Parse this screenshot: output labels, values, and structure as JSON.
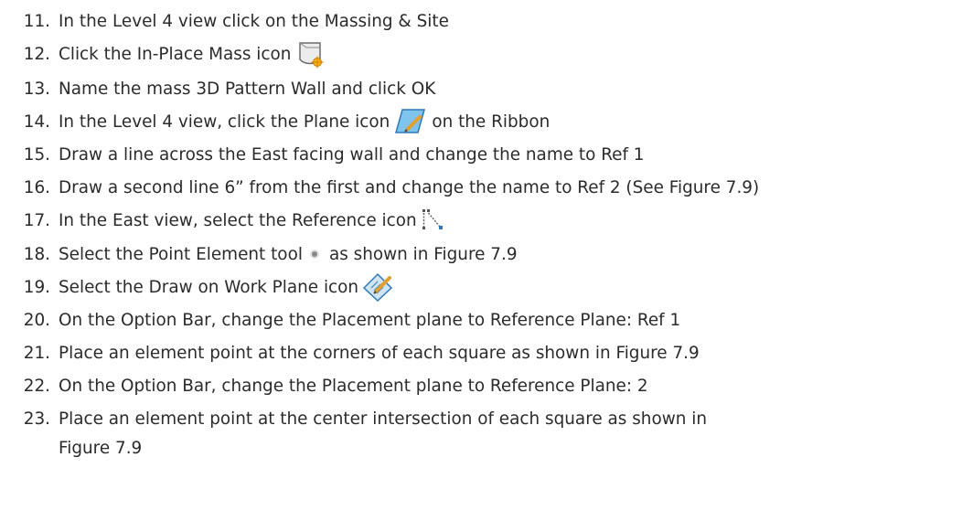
{
  "steps": [
    {
      "number": "11.",
      "text": "In the Level 4 view click on the Massing & Site"
    },
    {
      "number": "12.",
      "text": "Click the In-Place Mass icon",
      "icon": "in-place-mass-icon"
    },
    {
      "number": "13.",
      "text": "Name the mass 3D Pattern Wall and click OK"
    },
    {
      "number": "14.",
      "text": "In the Level 4 view, click the Plane icon",
      "icon": "plane-icon",
      "text_after": "on the Ribbon"
    },
    {
      "number": "15.",
      "text": "Draw a line across the East facing wall and change the name to Ref 1"
    },
    {
      "number": "16.",
      "text": "Draw a second line 6” from the first and change the name to Ref 2 (See Figure 7.9)"
    },
    {
      "number": "17.",
      "text": "In the East view, select the Reference icon",
      "icon": "reference-icon"
    },
    {
      "number": "18.",
      "text": "Select the Point Element tool",
      "icon": "point-element-icon",
      "text_after": "as shown in Figure 7.9"
    },
    {
      "number": "19.",
      "text": "Select the Draw on Work Plane icon",
      "icon": "draw-on-work-plane-icon"
    },
    {
      "number": "20.",
      "text": "On the Option Bar, change the Placement plane to Reference Plane: Ref 1"
    },
    {
      "number": "21.",
      "text": "Place an element point at the corners of each square as shown in Figure 7.9"
    },
    {
      "number": "22.",
      "text": "On the Option Bar, change the Placement plane to Reference Plane: 2"
    },
    {
      "number": "23.",
      "text": "Place an element point at the center intersection of each square as shown in",
      "continuation": "Figure 7.9"
    }
  ]
}
